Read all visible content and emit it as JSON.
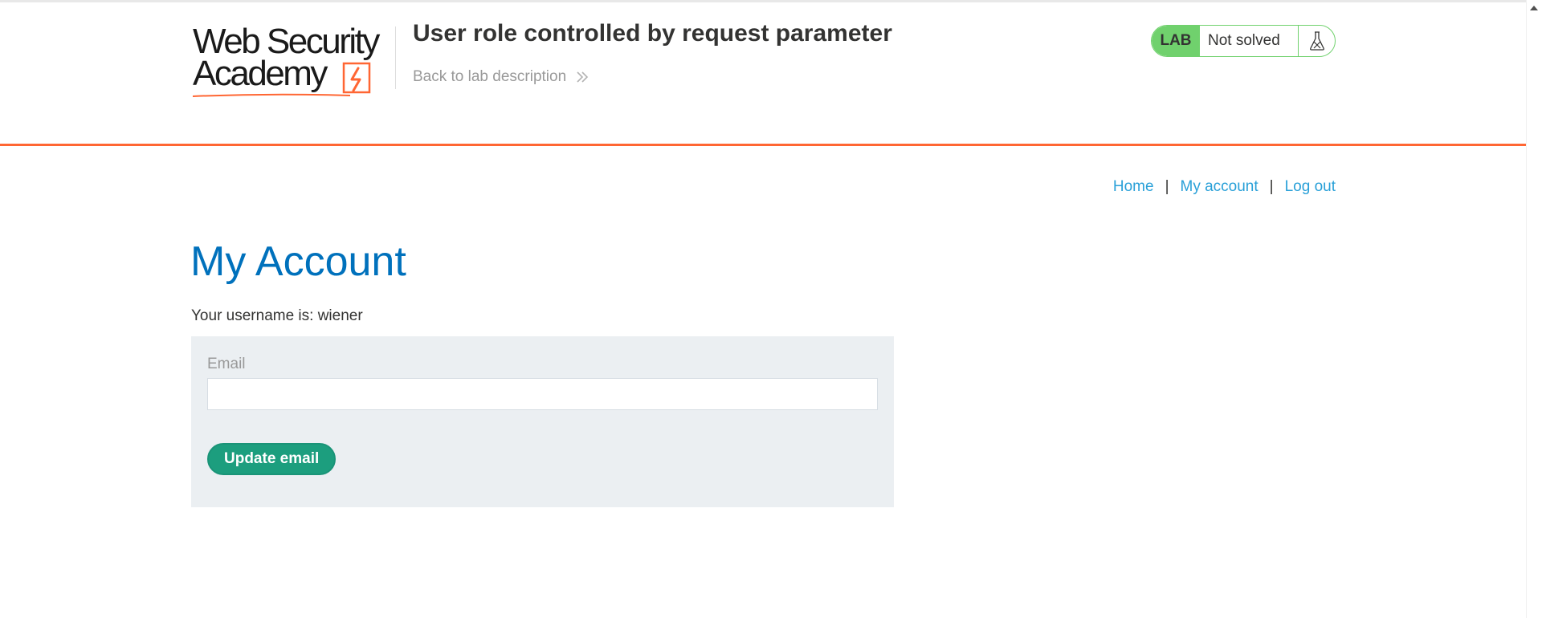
{
  "header": {
    "logo": {
      "line1": "Web Security",
      "line2": "Academy",
      "accent_color": "#ff6633"
    },
    "lab_title": "User role controlled by request parameter",
    "back_link": "Back to lab description",
    "lab_status": {
      "badge": "LAB",
      "state": "Not solved",
      "icon": "flask-icon",
      "color": "#70d16d"
    },
    "rule_color": "#ff6633"
  },
  "nav": {
    "home": "Home",
    "separator": "|",
    "my_account": "My account",
    "log_out": "Log out",
    "link_color": "#29a0d8"
  },
  "main": {
    "title": "My Account",
    "title_color": "#0071bc",
    "username_line": "Your username is: wiener",
    "email_form": {
      "label": "Email",
      "value": "",
      "submit_label": "Update email",
      "button_color": "#1c9e7e",
      "panel_color": "#ebeff2"
    }
  }
}
